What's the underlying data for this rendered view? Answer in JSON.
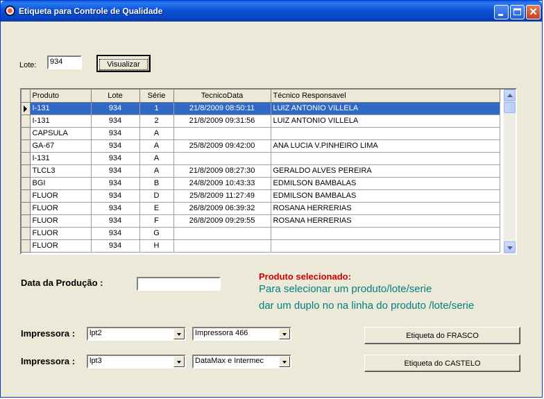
{
  "window": {
    "title": "Etiqueta para Controle de Qualidade"
  },
  "lote": {
    "label": "Lote:",
    "value": "934",
    "button": "Visualizar"
  },
  "grid": {
    "columns": [
      "Produto",
      "Lote",
      "Série",
      "TecnicoData",
      "Técnico Responsavel"
    ],
    "selected_row": 0,
    "rows": [
      [
        "I-131",
        "934",
        "1",
        "21/8/2009 08:50:11",
        "LUIZ ANTONIO VILLELA"
      ],
      [
        "I-131",
        "934",
        "2",
        "21/8/2009 09:31:56",
        "LUIZ ANTONIO VILLELA"
      ],
      [
        "CAPSULA",
        "934",
        "A",
        "",
        ""
      ],
      [
        "GA-67",
        "934",
        "A",
        "25/8/2009 09:42:00",
        "ANA LUCIA V.PINHEIRO LIMA"
      ],
      [
        "I-131",
        "934",
        "A",
        "",
        ""
      ],
      [
        "TLCL3",
        "934",
        "A",
        "21/8/2009 08:27:30",
        "GERALDO ALVES PEREIRA"
      ],
      [
        "BGI",
        "934",
        "B",
        "24/8/2009 10:43:33",
        "EDMILSON BAMBALAS"
      ],
      [
        "FLUOR",
        "934",
        "D",
        "25/8/2009 11:27:49",
        "EDMILSON BAMBALAS"
      ],
      [
        "FLUOR",
        "934",
        "E",
        "26/8/2009 06:39:32",
        "ROSANA HERRERIAS"
      ],
      [
        "FLUOR",
        "934",
        "F",
        "26/8/2009 09:29:55",
        "ROSANA HERRERIAS"
      ],
      [
        "FLUOR",
        "934",
        "G",
        "",
        ""
      ],
      [
        "FLUOR",
        "934",
        "H",
        "",
        ""
      ]
    ]
  },
  "producao": {
    "label": "Data da Produção :",
    "value": ""
  },
  "info": {
    "selected_label": "Produto selecionado:",
    "line1": "Para selecionar um produto/lote/serie",
    "line2": "dar um duplo no na linha do produto /lote/serie"
  },
  "printers": [
    {
      "label": "Impressora :",
      "port": "lpt2",
      "model": "Impressora 466",
      "button": "Etiqueta  do   FRASCO"
    },
    {
      "label": "Impressora :",
      "port": "lpt3",
      "model": "DataMax e Intermec",
      "button": "Etiqueta do CASTELO"
    }
  ],
  "colors": {
    "selection": "#316ac5",
    "title_red": "#cc0000",
    "info_teal": "#008080",
    "titlebar": "#0a53d6"
  }
}
